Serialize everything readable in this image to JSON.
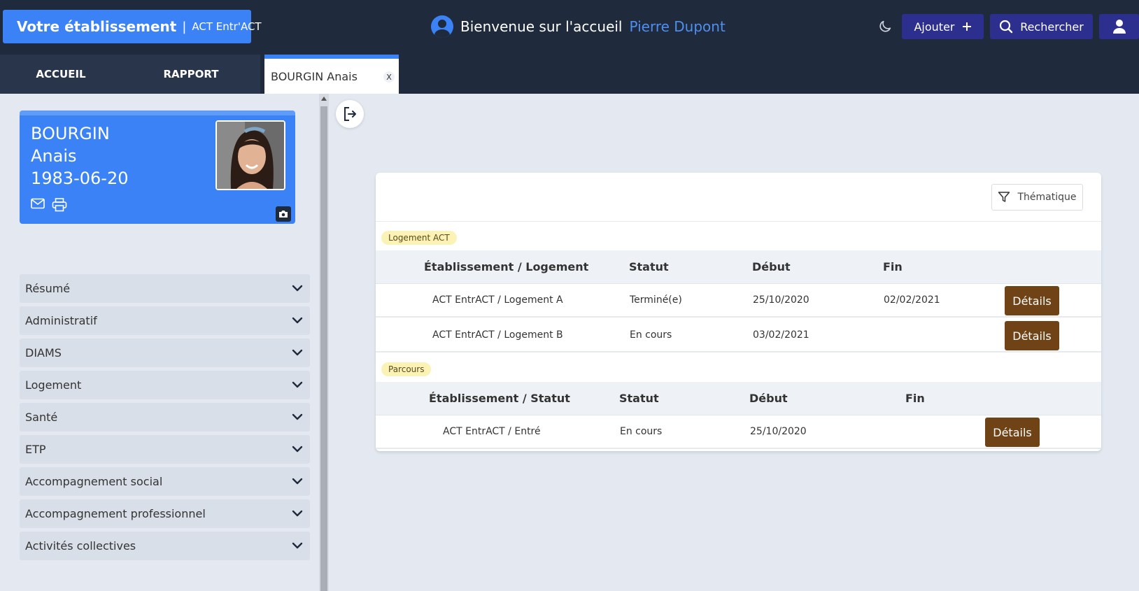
{
  "header": {
    "brand_name": "Votre établissement",
    "brand_separator": "|",
    "brand_sub": "ACT Entr'ACT",
    "welcome_text": "Bienvenue sur l'accueil",
    "user_name": "Pierre Dupont",
    "add_label": "Ajouter",
    "search_label": "Rechercher",
    "icons": [
      "user-circle-icon",
      "moon-icon",
      "plus-icon",
      "search-icon",
      "user-icon"
    ]
  },
  "tabs": {
    "home": "ACCUEIL",
    "report": "RAPPORT",
    "patient": "BOURGIN Anais",
    "close": "X"
  },
  "patient": {
    "last_name": "BOURGIN",
    "first_name": "Anais",
    "birth_date": "1983-06-20",
    "icons": [
      "mail-icon",
      "print-icon",
      "camera-icon"
    ]
  },
  "sidebar": {
    "sections": [
      {
        "label": "Résumé"
      },
      {
        "label": "Administratif"
      },
      {
        "label": "DIAMS"
      },
      {
        "label": "Logement"
      },
      {
        "label": "Santé"
      },
      {
        "label": "ETP"
      },
      {
        "label": "Accompagnement social"
      },
      {
        "label": "Accompagnement professionnel"
      },
      {
        "label": "Activités collectives"
      }
    ]
  },
  "main": {
    "filter_label": "Thématique",
    "logement": {
      "badge": "Logement ACT",
      "headers": [
        "Établissement / Logement",
        "Statut",
        "Début",
        "Fin"
      ],
      "rows": [
        {
          "etab": "ACT EntrACT / Logement A",
          "statut": "Terminé(e)",
          "debut": "25/10/2020",
          "fin": "02/02/2021",
          "action": "Détails"
        },
        {
          "etab": "ACT EntrACT / Logement B",
          "statut": "En cours",
          "debut": "03/02/2021",
          "fin": "",
          "action": "Détails"
        }
      ]
    },
    "parcours": {
      "badge": "Parcours",
      "headers": [
        "Établissement / Statut",
        "Statut",
        "Début",
        "Fin"
      ],
      "rows": [
        {
          "etab": "ACT EntrACT / Entré",
          "statut": "En cours",
          "debut": "25/10/2020",
          "fin": "",
          "action": "Détails"
        }
      ]
    }
  },
  "colors": {
    "header_bg": "#1f2a3c",
    "brand_blue": "#3b82f6",
    "button_indigo": "#2d2f8f",
    "details_brown": "#6f4315",
    "badge_yellow": "#fbf2b6"
  }
}
